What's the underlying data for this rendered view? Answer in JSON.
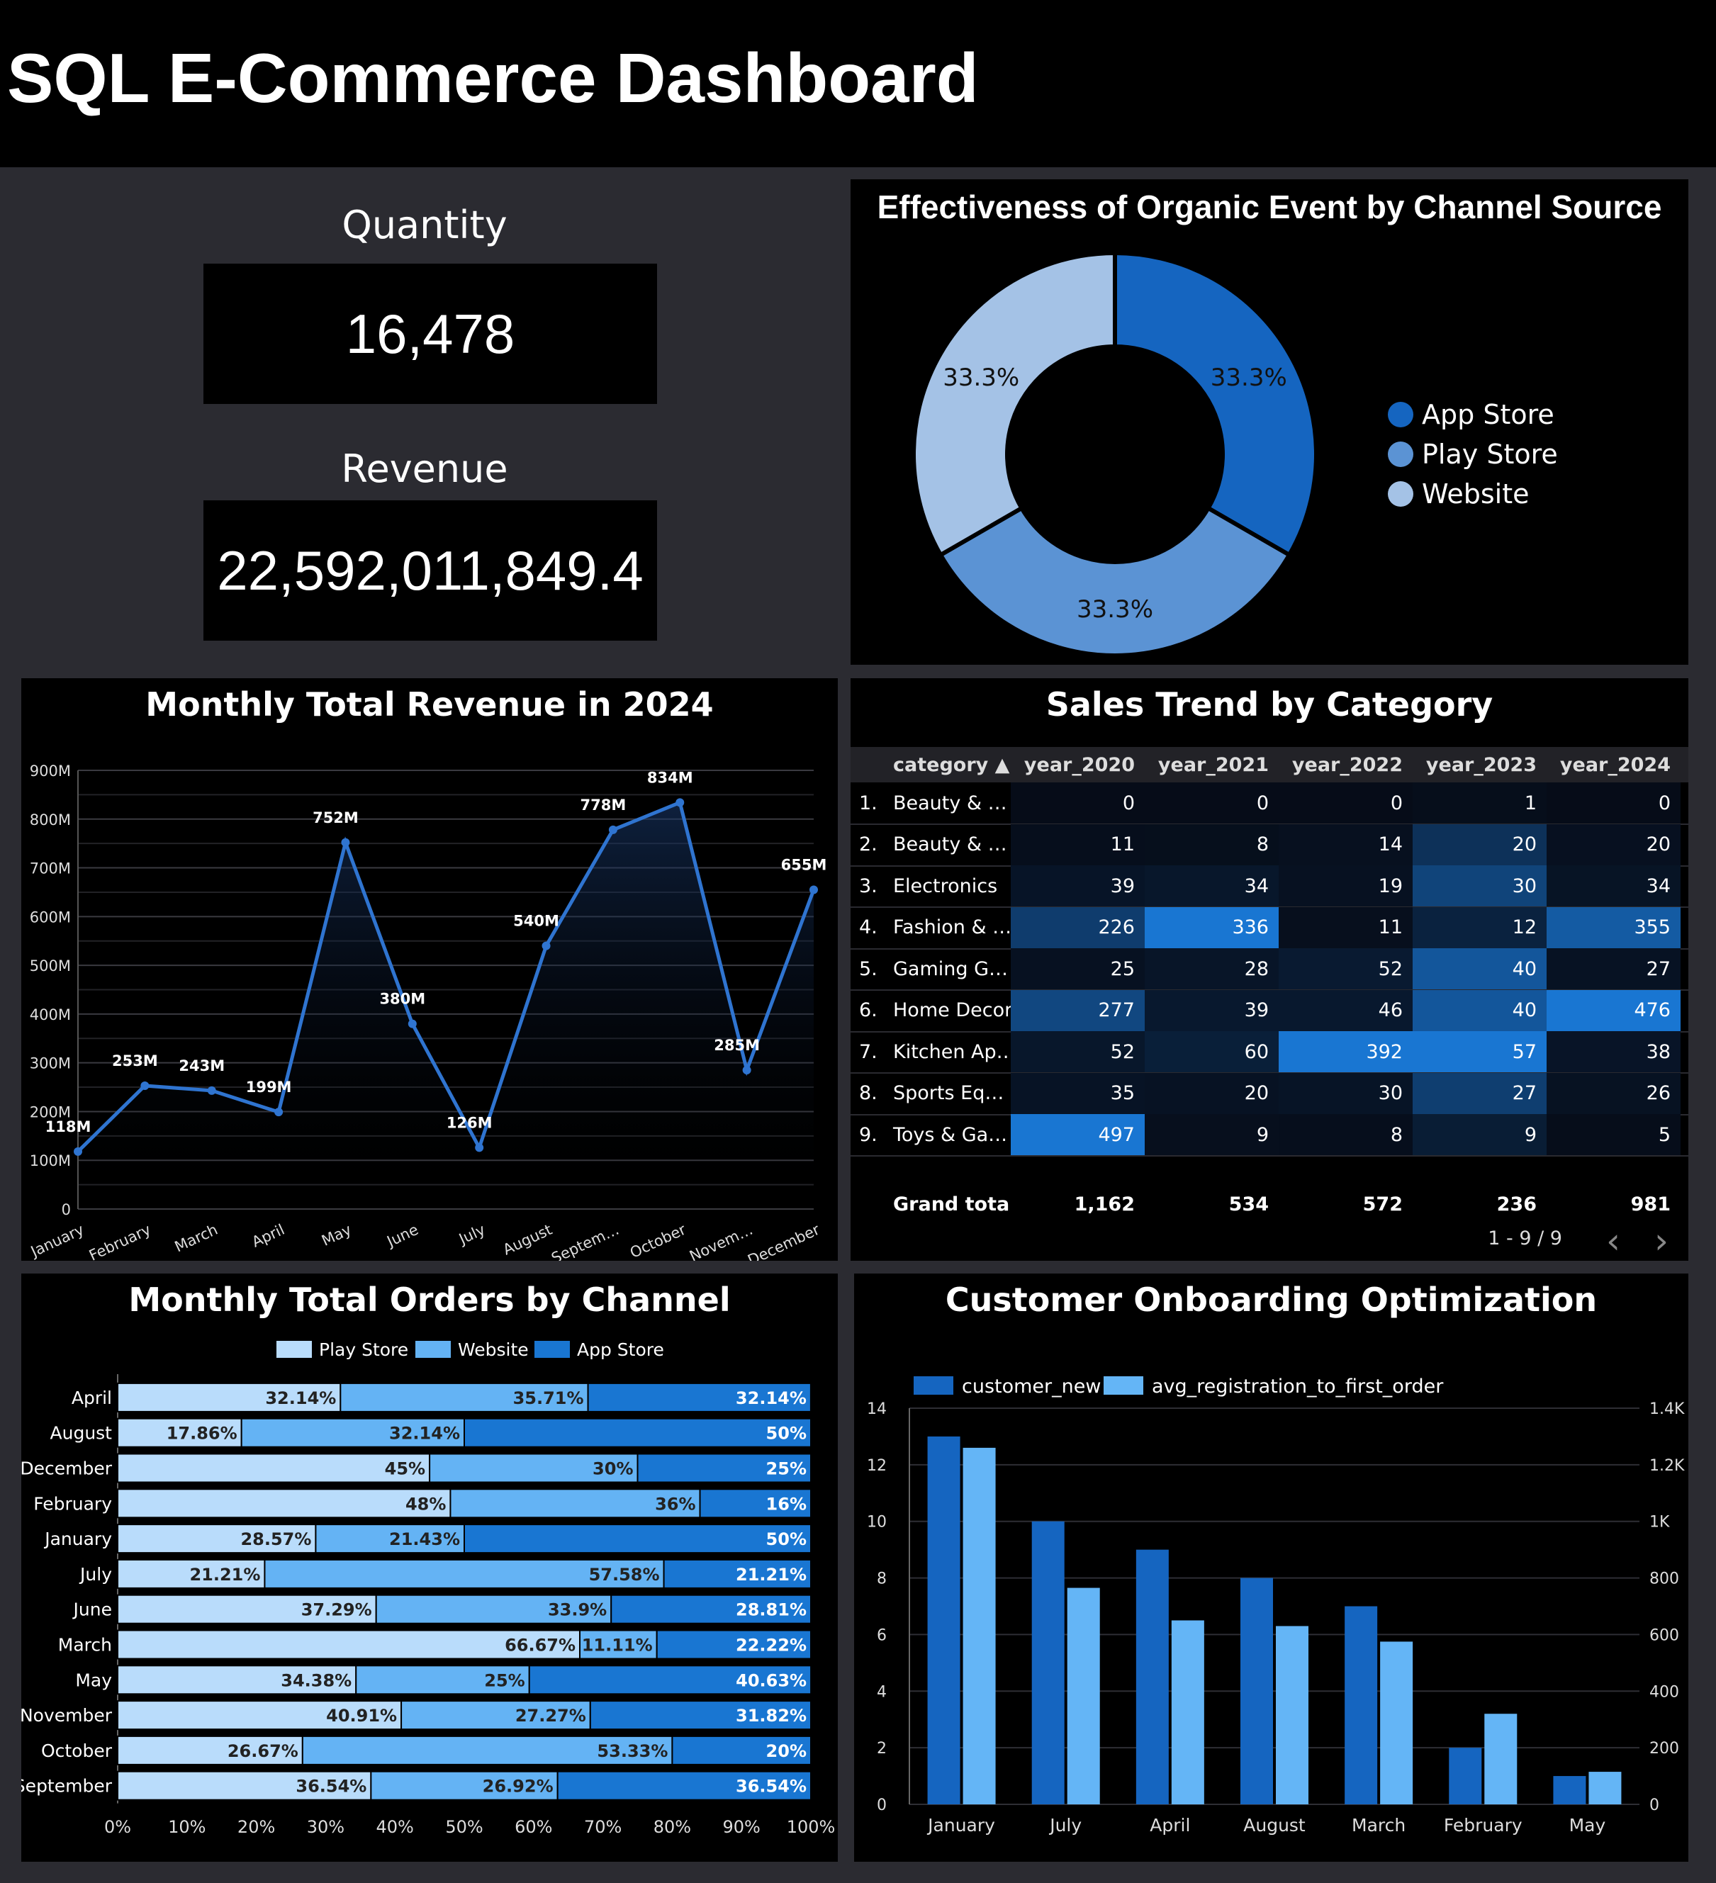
{
  "header": {
    "title": "SQL E-Commerce Dashboard"
  },
  "kpis": {
    "quantity": {
      "label": "Quantity",
      "value": "16,478"
    },
    "revenue": {
      "label": "Revenue",
      "value": "22,592,011,849.4"
    }
  },
  "donut": {
    "title": "Effectiveness of Organic Event by Channel Source",
    "chart_data": {
      "type": "pie",
      "labels": [
        "App Store",
        "Play Store",
        "Website"
      ],
      "values": [
        33.3,
        33.3,
        33.3
      ],
      "value_labels": [
        "33.3%",
        "33.3%",
        "33.3%"
      ],
      "colors": [
        "#1565c0",
        "#5b93d4",
        "#a4c2e6"
      ],
      "legend": "right"
    }
  },
  "revenue_chart": {
    "title": "Monthly Total Revenue in 2024",
    "chart_data": {
      "type": "line",
      "categories": [
        "January",
        "February",
        "March",
        "April",
        "May",
        "June",
        "July",
        "August",
        "Septem…",
        "October",
        "Novem…",
        "December"
      ],
      "values": [
        118,
        253,
        243,
        199,
        752,
        380,
        126,
        540,
        778,
        834,
        285,
        655
      ],
      "value_labels": [
        "118M",
        "253M",
        "243M",
        "199M",
        "752M",
        "380M",
        "126M",
        "540M",
        "778M",
        "834M",
        "285M",
        "655M"
      ],
      "y_ticks": [
        "0",
        "100M",
        "200M",
        "300M",
        "400M",
        "500M",
        "600M",
        "700M",
        "800M",
        "900M"
      ],
      "ylim": [
        0,
        900
      ],
      "color": "#2f74d0",
      "grid": true
    }
  },
  "sales_table": {
    "title": "Sales Trend by Category",
    "columns": [
      "category ▲",
      "year_2020",
      "year_2021",
      "year_2022",
      "year_2023",
      "year_2024"
    ],
    "rows": [
      {
        "idx": "1.",
        "category": "Beauty & …",
        "values": [
          "0",
          "0",
          "0",
          "1",
          "0"
        ]
      },
      {
        "idx": "2.",
        "category": "Beauty & …",
        "values": [
          "11",
          "8",
          "14",
          "20",
          "20"
        ]
      },
      {
        "idx": "3.",
        "category": "Electronics",
        "values": [
          "39",
          "34",
          "19",
          "30",
          "34"
        ]
      },
      {
        "idx": "4.",
        "category": "Fashion & …",
        "values": [
          "226",
          "336",
          "11",
          "12",
          "355"
        ]
      },
      {
        "idx": "5.",
        "category": "Gaming G…",
        "values": [
          "25",
          "28",
          "52",
          "40",
          "27"
        ]
      },
      {
        "idx": "6.",
        "category": "Home Decor",
        "values": [
          "277",
          "39",
          "46",
          "40",
          "476"
        ]
      },
      {
        "idx": "7.",
        "category": "Kitchen Ap…",
        "values": [
          "52",
          "60",
          "392",
          "57",
          "38"
        ]
      },
      {
        "idx": "8.",
        "category": "Sports Eq…",
        "values": [
          "35",
          "20",
          "30",
          "27",
          "26"
        ]
      },
      {
        "idx": "9.",
        "category": "Toys & Ga…",
        "values": [
          "497",
          "9",
          "8",
          "9",
          "5"
        ]
      }
    ],
    "grand_total": {
      "label": "Grand total",
      "values": [
        "1,162",
        "534",
        "572",
        "236",
        "981"
      ]
    },
    "pagination": {
      "text": "1 - 9 / 9",
      "prev": "‹",
      "next": "›"
    }
  },
  "orders_chart": {
    "title": "Monthly Total Orders by Channel",
    "chart_data": {
      "type": "bar",
      "orientation": "horizontal-stacked-100",
      "categories": [
        "April",
        "August",
        "December",
        "February",
        "January",
        "July",
        "June",
        "March",
        "May",
        "November",
        "October",
        "September"
      ],
      "series": [
        {
          "name": "Play Store",
          "color": "#b9dcfb",
          "values": [
            32.14,
            17.86,
            45,
            48,
            28.57,
            21.21,
            37.29,
            66.67,
            34.38,
            40.91,
            26.67,
            36.54
          ],
          "labels": [
            "32.14%",
            "17.86%",
            "45%",
            "48%",
            "28.57%",
            "21.21%",
            "37.29%",
            "66.67%",
            "34.38%",
            "40.91%",
            "26.67%",
            "36.54%"
          ]
        },
        {
          "name": "Website",
          "color": "#64b3f4",
          "values": [
            35.71,
            32.14,
            30,
            36,
            21.43,
            57.58,
            33.9,
            11.11,
            25,
            27.27,
            53.33,
            26.92
          ],
          "labels": [
            "35.71%",
            "32.14%",
            "30%",
            "36%",
            "21.43%",
            "57.58%",
            "33.9%",
            "11.11%",
            "25%",
            "27.27%",
            "53.33%",
            "26.92%"
          ]
        },
        {
          "name": "App Store",
          "color": "#1976d2",
          "values": [
            32.14,
            50,
            25,
            16,
            50,
            21.21,
            28.81,
            22.22,
            40.63,
            31.82,
            20,
            36.54
          ],
          "labels": [
            "32.14%",
            "50%",
            "25%",
            "16%",
            "50%",
            "21.21%",
            "28.81%",
            "22.22%",
            "40.63%",
            "31.82%",
            "20%",
            "36.54%"
          ]
        }
      ],
      "x_ticks": [
        "0%",
        "10%",
        "20%",
        "30%",
        "40%",
        "50%",
        "60%",
        "70%",
        "80%",
        "90%",
        "100%"
      ],
      "xlim": [
        0,
        100
      ],
      "legend": "top"
    }
  },
  "onboarding_chart": {
    "title": "Customer Onboarding Optimization",
    "chart_data": {
      "type": "bar",
      "categories": [
        "January",
        "July",
        "April",
        "August",
        "March",
        "February",
        "May"
      ],
      "series": [
        {
          "name": "customer_new",
          "axis": "left",
          "color": "#1565c0",
          "values": [
            13,
            10,
            9,
            8,
            7,
            2,
            1
          ]
        },
        {
          "name": "avg_registration_to_first_order",
          "axis": "right",
          "color": "#64b5f6",
          "values": [
            1260,
            765,
            650,
            630,
            575,
            320,
            115
          ]
        }
      ],
      "y_left_ticks": [
        "0",
        "2",
        "4",
        "6",
        "8",
        "10",
        "12",
        "14"
      ],
      "y_left_lim": [
        0,
        14
      ],
      "y_right_ticks": [
        "0",
        "200",
        "400",
        "600",
        "800",
        "1K",
        "1.2K",
        "1.4K"
      ],
      "y_right_lim": [
        0,
        1400
      ],
      "legend": "top"
    }
  }
}
